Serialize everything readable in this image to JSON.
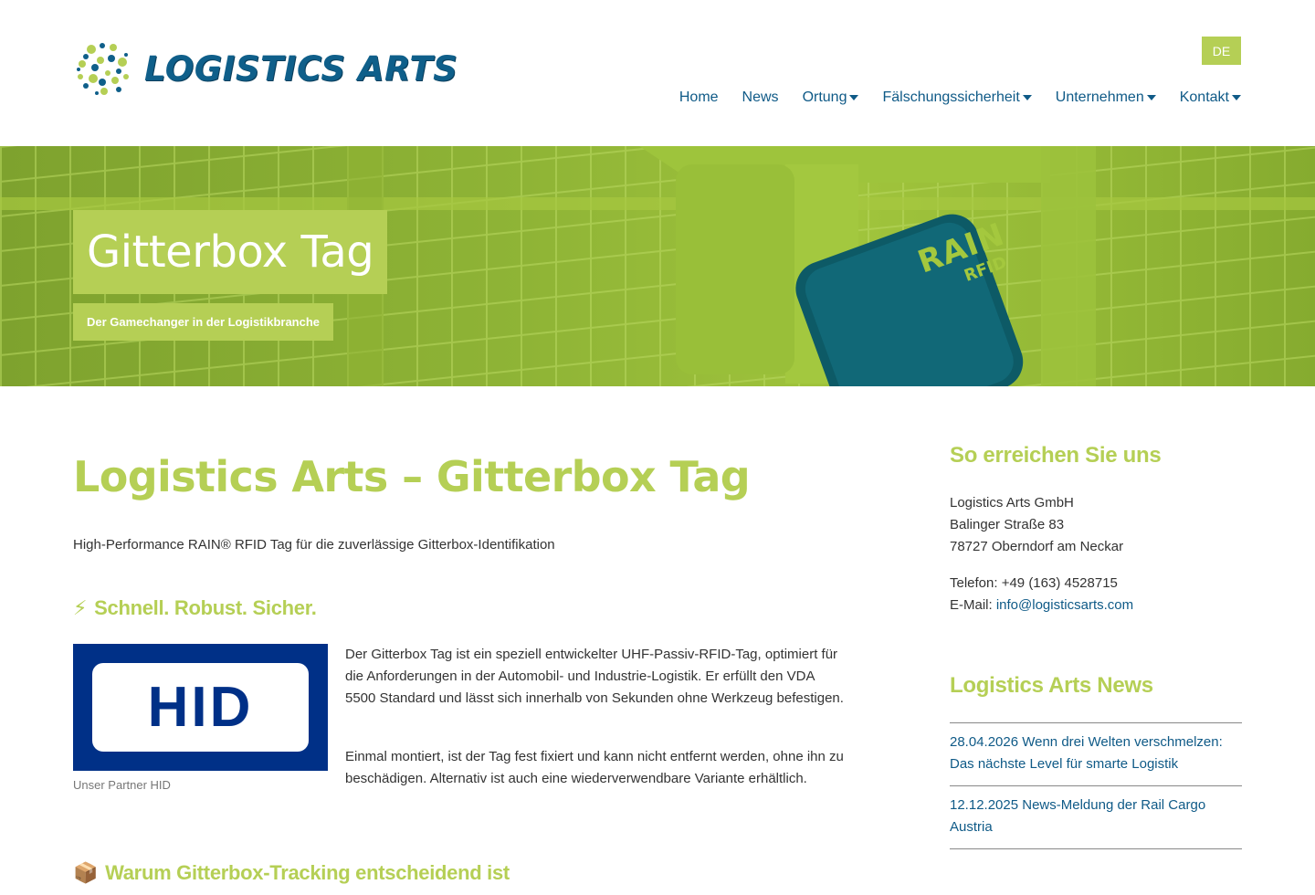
{
  "header": {
    "logo_text": "LOGISTICS ARTS",
    "lang_label": "DE",
    "nav": [
      {
        "label": "Home",
        "has_dropdown": false
      },
      {
        "label": "News",
        "has_dropdown": false
      },
      {
        "label": "Ortung",
        "has_dropdown": true
      },
      {
        "label": "Fälschungssicherheit",
        "has_dropdown": true
      },
      {
        "label": "Unternehmen",
        "has_dropdown": true
      },
      {
        "label": "Kontakt",
        "has_dropdown": true
      }
    ]
  },
  "hero": {
    "title": "Gitterbox Tag",
    "subtitle": "Der Gamechanger in der Logistikbranche",
    "tag_label_main": "RAIN",
    "tag_label_sub": "RFID"
  },
  "main": {
    "title": "Logistics Arts – Gitterbox Tag",
    "intro": "High-Performance RAIN® RFID Tag für die zuverlässige Gitterbox-Identifikation",
    "section1": {
      "emoji": "⚡",
      "heading": "Schnell. Robust. Sicher."
    },
    "partner_logo_text": "HID",
    "partner_caption": "Unser Partner HID",
    "paragraph1": "Der Gitterbox Tag ist ein speziell entwickelter UHF-Passiv-RFID-Tag, optimiert für die Anforderungen in der Automobil- und Industrie-Logistik. Er erfüllt den VDA 5500 Standard und lässt sich innerhalb von Sekunden ohne Werkzeug befestigen.",
    "paragraph2": "Einmal montiert, ist der Tag fest fixiert und kann nicht entfernt werden, ohne ihn zu beschädigen. Alternativ ist auch eine wiederverwendbare Variante erhältlich.",
    "section2": {
      "emoji": "📦",
      "heading": "Warum Gitterbox-Tracking entscheidend ist"
    }
  },
  "sidebar": {
    "contact_heading": "So erreichen Sie uns",
    "address": [
      "Logistics Arts GmbH",
      "Balinger Straße 83",
      "78727 Oberndorf am Neckar"
    ],
    "phone_label": "Telefon: +49 (163) 4528715",
    "email_prefix": "E-Mail: ",
    "email": "info@logisticsarts.com",
    "news_heading": "Logistics Arts News",
    "news": [
      {
        "text": "28.04.2026 Wenn drei Welten verschmelzen: Das nächste Level für smarte Logistik"
      },
      {
        "text": "12.12.2025 News-Meldung der Rail Cargo Austria"
      }
    ]
  },
  "colors": {
    "accent_green": "#b5cf55",
    "link_blue": "#0f5a87",
    "hid_blue": "#003087"
  }
}
